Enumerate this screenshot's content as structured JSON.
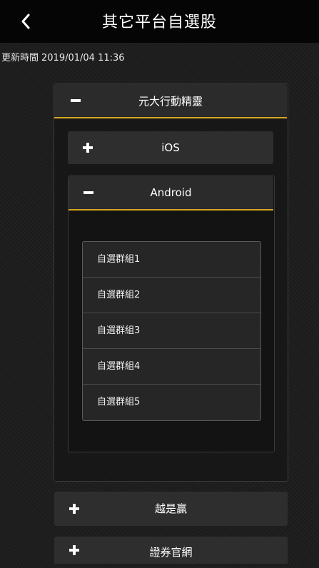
{
  "header": {
    "title": "其它平台自選股"
  },
  "update": {
    "label": "更新時間",
    "value": "2019/01/04 11:36"
  },
  "sections": [
    {
      "label": "元大行動精靈",
      "expanded": true,
      "subsections": [
        {
          "label": "iOS",
          "expanded": false
        },
        {
          "label": "Android",
          "expanded": true,
          "groups": [
            "自選群組1",
            "自選群組2",
            "自選群組3",
            "自選群組4",
            "自選群組5"
          ]
        }
      ]
    },
    {
      "label": "越是贏",
      "expanded": false
    },
    {
      "label": "證券官網",
      "expanded": false
    }
  ],
  "colors": {
    "accent": "#d4a520",
    "header_bg": "#050505",
    "panel_bg": "#2b2b2b"
  },
  "icons": {
    "back": "chevron-left-icon",
    "expand": "plus-icon",
    "collapse": "minus-icon"
  }
}
